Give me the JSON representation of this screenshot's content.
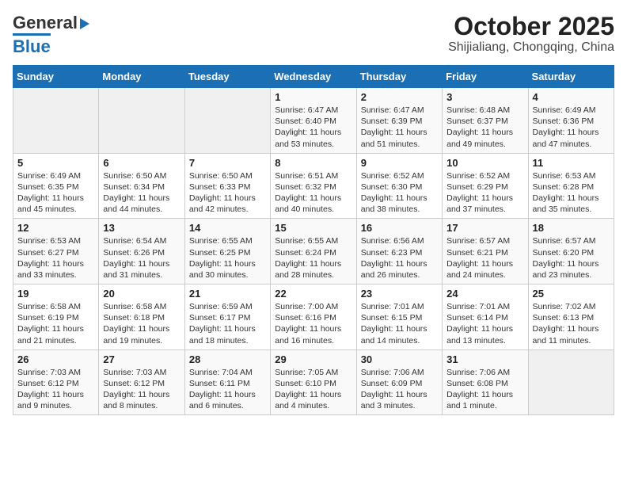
{
  "header": {
    "logo_general": "General",
    "logo_blue": "Blue",
    "title": "October 2025",
    "subtitle": "Shijialiang, Chongqing, China"
  },
  "weekdays": [
    "Sunday",
    "Monday",
    "Tuesday",
    "Wednesday",
    "Thursday",
    "Friday",
    "Saturday"
  ],
  "weeks": [
    [
      {
        "day": "",
        "info": ""
      },
      {
        "day": "",
        "info": ""
      },
      {
        "day": "",
        "info": ""
      },
      {
        "day": "1",
        "info": "Sunrise: 6:47 AM\nSunset: 6:40 PM\nDaylight: 11 hours\nand 53 minutes."
      },
      {
        "day": "2",
        "info": "Sunrise: 6:47 AM\nSunset: 6:39 PM\nDaylight: 11 hours\nand 51 minutes."
      },
      {
        "day": "3",
        "info": "Sunrise: 6:48 AM\nSunset: 6:37 PM\nDaylight: 11 hours\nand 49 minutes."
      },
      {
        "day": "4",
        "info": "Sunrise: 6:49 AM\nSunset: 6:36 PM\nDaylight: 11 hours\nand 47 minutes."
      }
    ],
    [
      {
        "day": "5",
        "info": "Sunrise: 6:49 AM\nSunset: 6:35 PM\nDaylight: 11 hours\nand 45 minutes."
      },
      {
        "day": "6",
        "info": "Sunrise: 6:50 AM\nSunset: 6:34 PM\nDaylight: 11 hours\nand 44 minutes."
      },
      {
        "day": "7",
        "info": "Sunrise: 6:50 AM\nSunset: 6:33 PM\nDaylight: 11 hours\nand 42 minutes."
      },
      {
        "day": "8",
        "info": "Sunrise: 6:51 AM\nSunset: 6:32 PM\nDaylight: 11 hours\nand 40 minutes."
      },
      {
        "day": "9",
        "info": "Sunrise: 6:52 AM\nSunset: 6:30 PM\nDaylight: 11 hours\nand 38 minutes."
      },
      {
        "day": "10",
        "info": "Sunrise: 6:52 AM\nSunset: 6:29 PM\nDaylight: 11 hours\nand 37 minutes."
      },
      {
        "day": "11",
        "info": "Sunrise: 6:53 AM\nSunset: 6:28 PM\nDaylight: 11 hours\nand 35 minutes."
      }
    ],
    [
      {
        "day": "12",
        "info": "Sunrise: 6:53 AM\nSunset: 6:27 PM\nDaylight: 11 hours\nand 33 minutes."
      },
      {
        "day": "13",
        "info": "Sunrise: 6:54 AM\nSunset: 6:26 PM\nDaylight: 11 hours\nand 31 minutes."
      },
      {
        "day": "14",
        "info": "Sunrise: 6:55 AM\nSunset: 6:25 PM\nDaylight: 11 hours\nand 30 minutes."
      },
      {
        "day": "15",
        "info": "Sunrise: 6:55 AM\nSunset: 6:24 PM\nDaylight: 11 hours\nand 28 minutes."
      },
      {
        "day": "16",
        "info": "Sunrise: 6:56 AM\nSunset: 6:23 PM\nDaylight: 11 hours\nand 26 minutes."
      },
      {
        "day": "17",
        "info": "Sunrise: 6:57 AM\nSunset: 6:21 PM\nDaylight: 11 hours\nand 24 minutes."
      },
      {
        "day": "18",
        "info": "Sunrise: 6:57 AM\nSunset: 6:20 PM\nDaylight: 11 hours\nand 23 minutes."
      }
    ],
    [
      {
        "day": "19",
        "info": "Sunrise: 6:58 AM\nSunset: 6:19 PM\nDaylight: 11 hours\nand 21 minutes."
      },
      {
        "day": "20",
        "info": "Sunrise: 6:58 AM\nSunset: 6:18 PM\nDaylight: 11 hours\nand 19 minutes."
      },
      {
        "day": "21",
        "info": "Sunrise: 6:59 AM\nSunset: 6:17 PM\nDaylight: 11 hours\nand 18 minutes."
      },
      {
        "day": "22",
        "info": "Sunrise: 7:00 AM\nSunset: 6:16 PM\nDaylight: 11 hours\nand 16 minutes."
      },
      {
        "day": "23",
        "info": "Sunrise: 7:01 AM\nSunset: 6:15 PM\nDaylight: 11 hours\nand 14 minutes."
      },
      {
        "day": "24",
        "info": "Sunrise: 7:01 AM\nSunset: 6:14 PM\nDaylight: 11 hours\nand 13 minutes."
      },
      {
        "day": "25",
        "info": "Sunrise: 7:02 AM\nSunset: 6:13 PM\nDaylight: 11 hours\nand 11 minutes."
      }
    ],
    [
      {
        "day": "26",
        "info": "Sunrise: 7:03 AM\nSunset: 6:12 PM\nDaylight: 11 hours\nand 9 minutes."
      },
      {
        "day": "27",
        "info": "Sunrise: 7:03 AM\nSunset: 6:12 PM\nDaylight: 11 hours\nand 8 minutes."
      },
      {
        "day": "28",
        "info": "Sunrise: 7:04 AM\nSunset: 6:11 PM\nDaylight: 11 hours\nand 6 minutes."
      },
      {
        "day": "29",
        "info": "Sunrise: 7:05 AM\nSunset: 6:10 PM\nDaylight: 11 hours\nand 4 minutes."
      },
      {
        "day": "30",
        "info": "Sunrise: 7:06 AM\nSunset: 6:09 PM\nDaylight: 11 hours\nand 3 minutes."
      },
      {
        "day": "31",
        "info": "Sunrise: 7:06 AM\nSunset: 6:08 PM\nDaylight: 11 hours\nand 1 minute."
      },
      {
        "day": "",
        "info": ""
      }
    ]
  ]
}
